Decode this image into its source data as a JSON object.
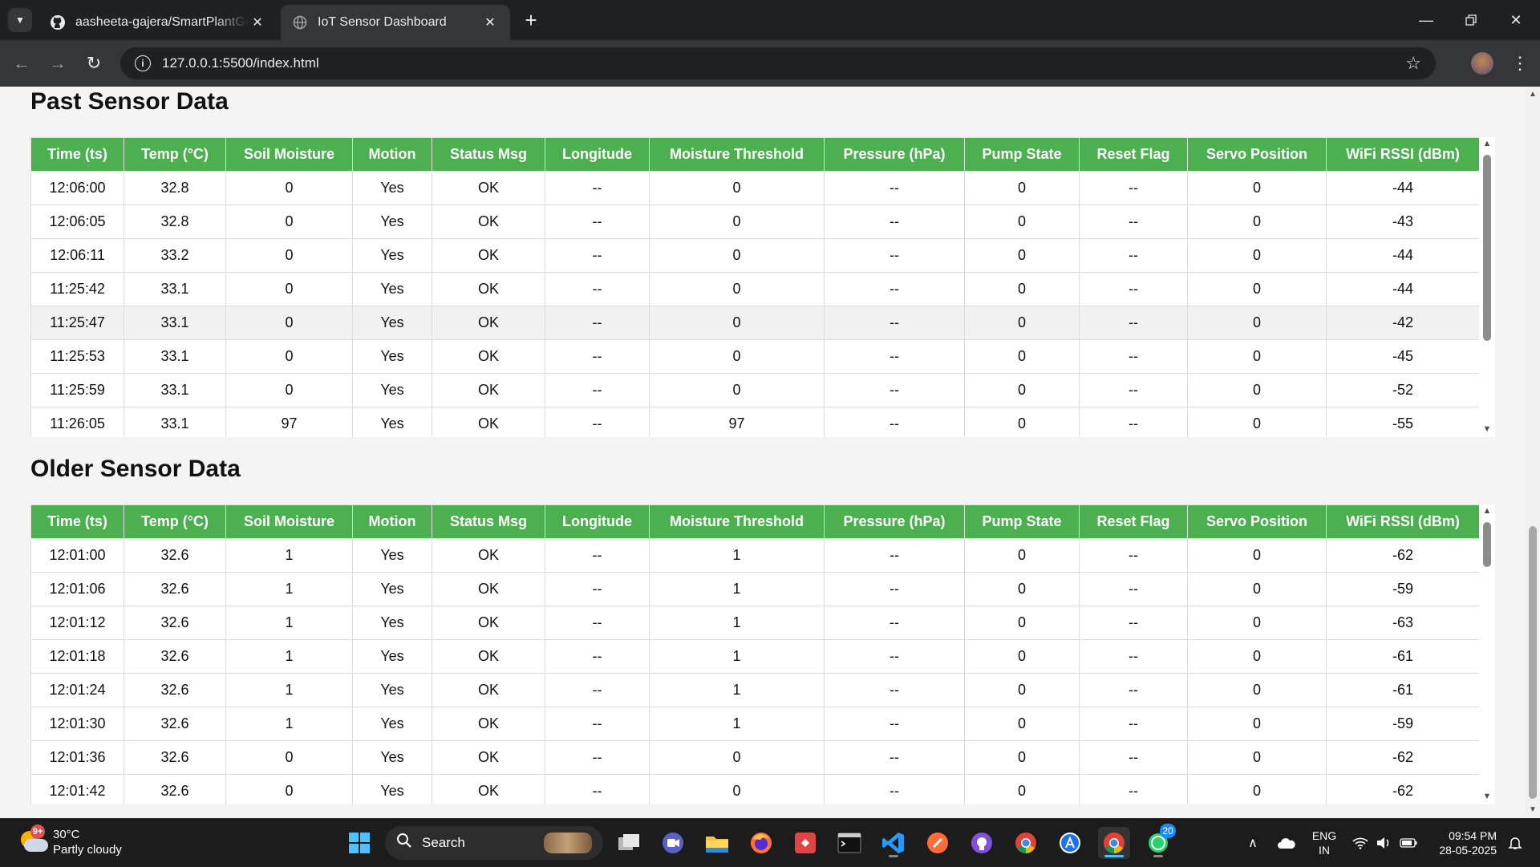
{
  "browser": {
    "tabs": [
      {
        "title": "aasheeta-gajera/SmartPlantGuard",
        "icon": "github-icon"
      },
      {
        "title": "IoT Sensor Dashboard",
        "icon": "globe-icon"
      }
    ],
    "url": "127.0.0.1:5500/index.html"
  },
  "headers": [
    "Time (ts)",
    "Temp (°C)",
    "Soil Moisture",
    "Motion",
    "Status Msg",
    "Longitude",
    "Moisture Threshold",
    "Pressure (hPa)",
    "Pump State",
    "Reset Flag",
    "Servo Position",
    "WiFi RSSI (dBm)"
  ],
  "past": {
    "title": "Past Sensor Data",
    "rows": [
      [
        "12:06:00",
        "32.8",
        "0",
        "Yes",
        "OK",
        "--",
        "0",
        "--",
        "0",
        "--",
        "0",
        "-44"
      ],
      [
        "12:06:05",
        "32.8",
        "0",
        "Yes",
        "OK",
        "--",
        "0",
        "--",
        "0",
        "--",
        "0",
        "-43"
      ],
      [
        "12:06:11",
        "33.2",
        "0",
        "Yes",
        "OK",
        "--",
        "0",
        "--",
        "0",
        "--",
        "0",
        "-44"
      ],
      [
        "11:25:42",
        "33.1",
        "0",
        "Yes",
        "OK",
        "--",
        "0",
        "--",
        "0",
        "--",
        "0",
        "-44"
      ],
      [
        "11:25:47",
        "33.1",
        "0",
        "Yes",
        "OK",
        "--",
        "0",
        "--",
        "0",
        "--",
        "0",
        "-42"
      ],
      [
        "11:25:53",
        "33.1",
        "0",
        "Yes",
        "OK",
        "--",
        "0",
        "--",
        "0",
        "--",
        "0",
        "-45"
      ],
      [
        "11:25:59",
        "33.1",
        "0",
        "Yes",
        "OK",
        "--",
        "0",
        "--",
        "0",
        "--",
        "0",
        "-52"
      ],
      [
        "11:26:05",
        "33.1",
        "97",
        "Yes",
        "OK",
        "--",
        "97",
        "--",
        "0",
        "--",
        "0",
        "-55"
      ]
    ]
  },
  "older": {
    "title": "Older Sensor Data",
    "rows": [
      [
        "12:01:00",
        "32.6",
        "1",
        "Yes",
        "OK",
        "--",
        "1",
        "--",
        "0",
        "--",
        "0",
        "-62"
      ],
      [
        "12:01:06",
        "32.6",
        "1",
        "Yes",
        "OK",
        "--",
        "1",
        "--",
        "0",
        "--",
        "0",
        "-59"
      ],
      [
        "12:01:12",
        "32.6",
        "1",
        "Yes",
        "OK",
        "--",
        "1",
        "--",
        "0",
        "--",
        "0",
        "-63"
      ],
      [
        "12:01:18",
        "32.6",
        "1",
        "Yes",
        "OK",
        "--",
        "1",
        "--",
        "0",
        "--",
        "0",
        "-61"
      ],
      [
        "12:01:24",
        "32.6",
        "1",
        "Yes",
        "OK",
        "--",
        "1",
        "--",
        "0",
        "--",
        "0",
        "-61"
      ],
      [
        "12:01:30",
        "32.6",
        "1",
        "Yes",
        "OK",
        "--",
        "1",
        "--",
        "0",
        "--",
        "0",
        "-59"
      ],
      [
        "12:01:36",
        "32.6",
        "0",
        "Yes",
        "OK",
        "--",
        "0",
        "--",
        "0",
        "--",
        "0",
        "-62"
      ],
      [
        "12:01:42",
        "32.6",
        "0",
        "Yes",
        "OK",
        "--",
        "0",
        "--",
        "0",
        "--",
        "0",
        "-62"
      ]
    ]
  },
  "taskbar": {
    "weather_temp": "30°C",
    "weather_desc": "Partly cloudy",
    "weather_badge": "9+",
    "search_placeholder": "Search",
    "lang_1": "ENG",
    "lang_2": "IN",
    "time": "09:54 PM",
    "date": "28-05-2025",
    "whatsapp_badge": "20"
  },
  "colors": {
    "header_green": "#4caf50",
    "highlight_row": "#f1f1f1"
  }
}
